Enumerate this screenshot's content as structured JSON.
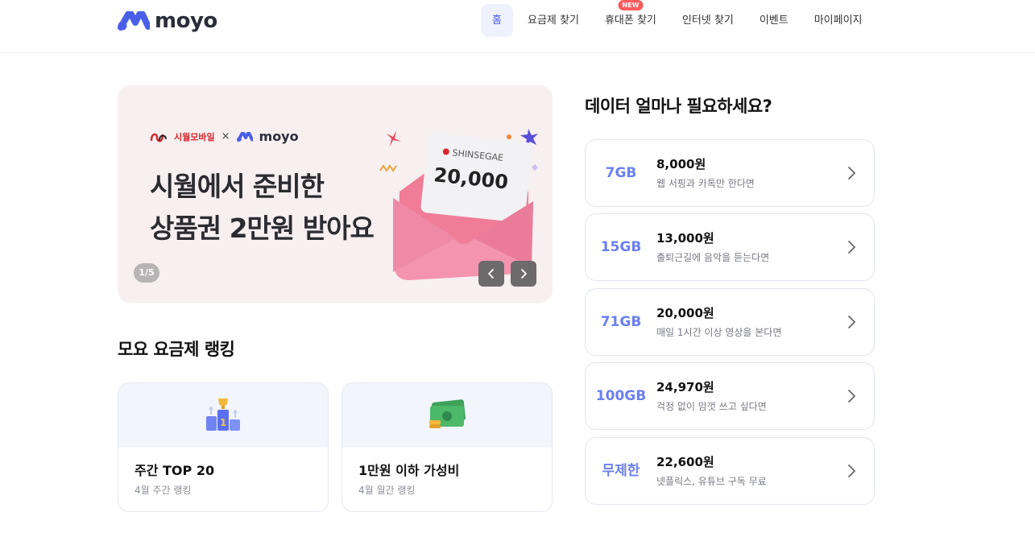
{
  "header": {
    "logo_text": "moyo",
    "nav": [
      {
        "label": "홈",
        "active": true
      },
      {
        "label": "요금제 찾기"
      },
      {
        "label": "휴대폰 찾기",
        "badge": "NEW"
      },
      {
        "label": "인터넷 찾기"
      },
      {
        "label": "이벤트"
      },
      {
        "label": "마이페이지"
      }
    ]
  },
  "banner": {
    "brand_partner": "시월모바일",
    "brand_x": "×",
    "brand_moyo": "moyo",
    "title_line1": "시월에서 준비한",
    "title_line2": "상품권 2만원 받아요",
    "voucher_brand": "SHINSEGAE",
    "voucher_amount": "20,000",
    "counter": "1/5"
  },
  "ranking": {
    "title": "모요 요금제 랭킹",
    "cards": [
      {
        "title": "주간 TOP 20",
        "subtitle": "4월 주간 랭킹",
        "icon": "trophy-podium-icon"
      },
      {
        "title": "1만원 이하 가성비",
        "subtitle": "4월 월간 랭킹",
        "icon": "money-icon"
      }
    ]
  },
  "data_usage": {
    "title": "데이터 얼마나 필요하세요?",
    "options": [
      {
        "amount": "7GB",
        "price": "8,000원",
        "desc": "웹 서핑과 카톡만 한다면"
      },
      {
        "amount": "15GB",
        "price": "13,000원",
        "desc": "출퇴근길에 음악을 듣는다면"
      },
      {
        "amount": "71GB",
        "price": "20,000원",
        "desc": "매일 1시간 이상 영상을 본다면"
      },
      {
        "amount": "100GB",
        "price": "24,970원",
        "desc": "걱정 없이 맘껏 쓰고 싶다면"
      },
      {
        "amount": "무제한",
        "price": "22,600원",
        "desc": "넷플릭스, 유튜브 구독 무료"
      }
    ]
  },
  "colors": {
    "accent": "#6b7ff0",
    "nav_active_bg": "#eff1fd",
    "banner_bg": "#f7eff0",
    "badge": "#ff5b5b"
  }
}
